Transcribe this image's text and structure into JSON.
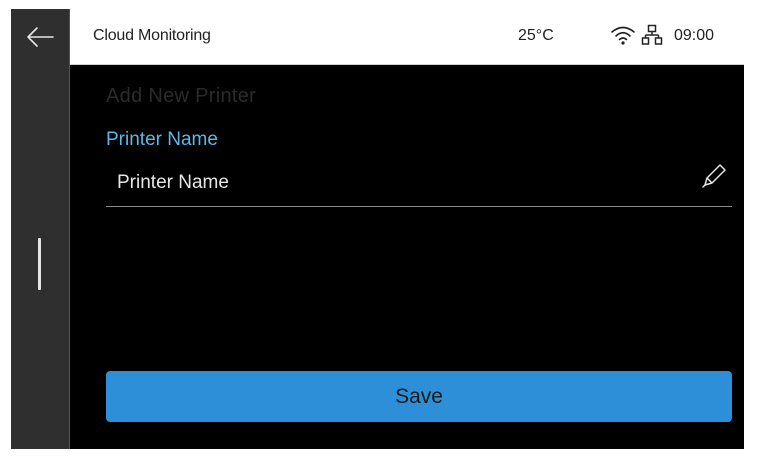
{
  "header": {
    "title": "Cloud Monitoring",
    "temperature": "25°C",
    "time": "09:00",
    "icons": [
      "back-arrow-icon",
      "wifi-icon",
      "network-icon"
    ]
  },
  "main": {
    "page_title": "Add New Printer",
    "field": {
      "label": "Printer Name",
      "value": "Printer Name",
      "edit_icon": "pencil-icon"
    },
    "save_label": "Save"
  },
  "colors": {
    "background": "#000000",
    "rail": "#2f2f2f",
    "accent_label": "#5fb6e8",
    "button": "#2d8fd8"
  }
}
